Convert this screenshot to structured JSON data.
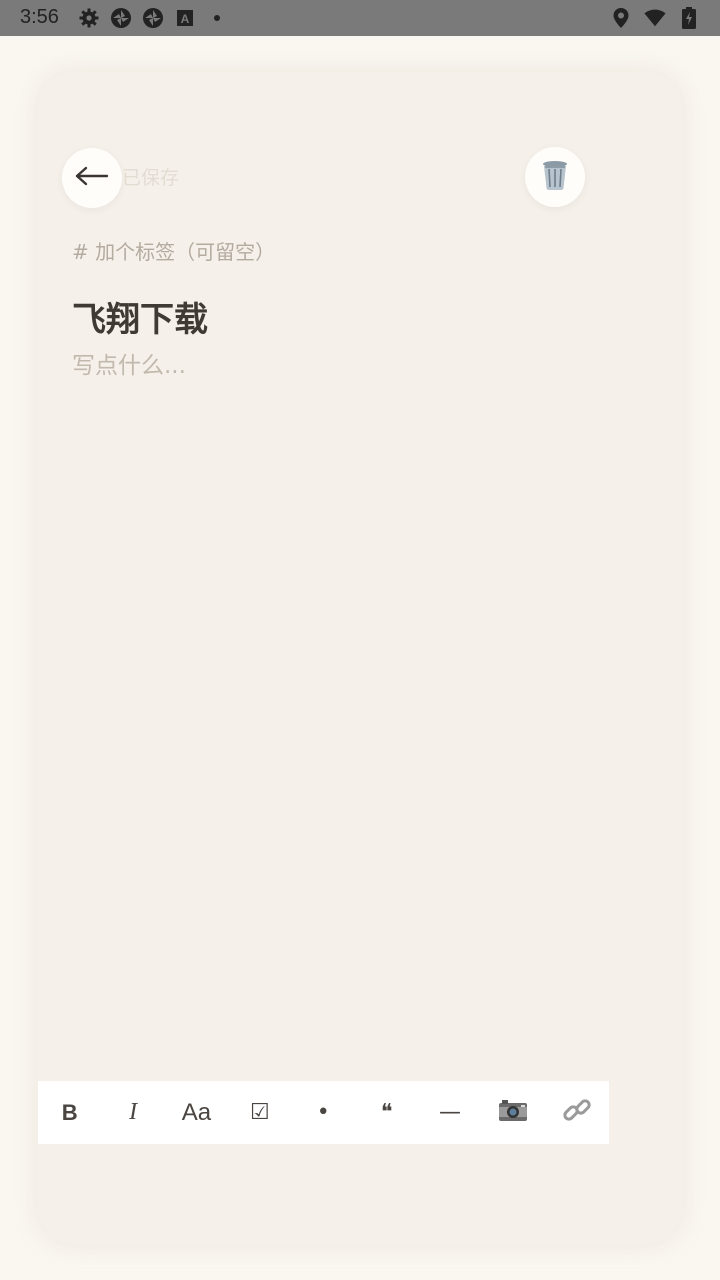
{
  "status_bar": {
    "time": "3:56",
    "left_icons": [
      "gear-icon",
      "aperture-icon",
      "aperture-icon",
      "font-icon",
      "dot-icon"
    ],
    "right_icons": [
      "location-icon",
      "wifi-icon",
      "battery-charging-icon"
    ]
  },
  "header": {
    "save_status": "已保存",
    "back_icon": "back-arrow-icon",
    "trash_icon": "trash-icon"
  },
  "editor": {
    "tag_placeholder": "# 加个标签（可留空）",
    "title": "飞翔下载",
    "body_placeholder": "写点什么..."
  },
  "toolbar": {
    "bold": "B",
    "italic": "I",
    "text_size": "Aa",
    "checkbox": "☑",
    "bullet": "•",
    "quote": "❝",
    "divider": "—"
  },
  "colors": {
    "background": "#faf6f0",
    "card": "#f5f0e9",
    "text_primary": "#3f3a34",
    "text_placeholder": "#c2b9ae",
    "statusbar": "#7a7a7a"
  }
}
